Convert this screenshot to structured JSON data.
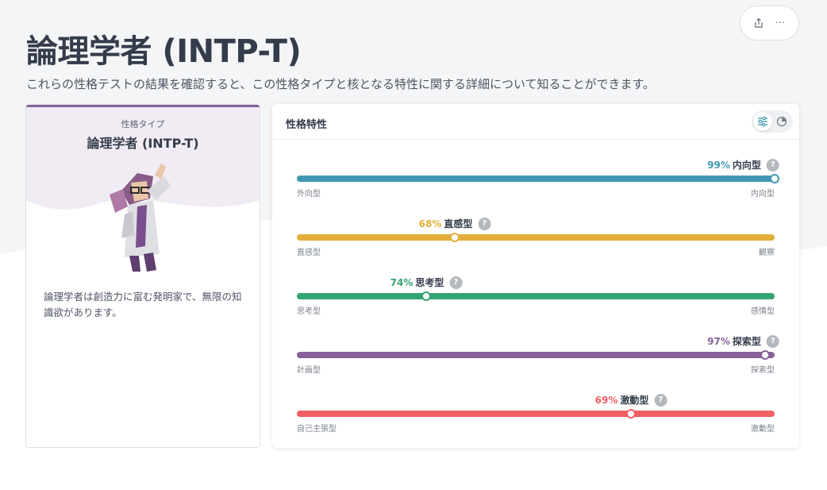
{
  "page": {
    "title": "論理学者 (INTP-T)",
    "description": "これらの性格テストの結果を確認すると、この性格タイプと核となる特性に関する詳細について知ることができます。"
  },
  "top_actions": {
    "icons": [
      "share-icon",
      "more-icon"
    ],
    "more_glyph": "···"
  },
  "type_card": {
    "kicker": "性格タイプ",
    "name": "論理学者 (INTP-T)",
    "description": "論理学者は創造力に富む発明家で、無限の知識欲があります。",
    "accent": "#88619a"
  },
  "traits_card": {
    "title": "性格特性",
    "view_toggle": [
      "sliders-icon",
      "pie-chart-icon"
    ],
    "traits": [
      {
        "percent": "99%",
        "name": "内向型",
        "left_pole": "外向型",
        "right_pole": "内向型",
        "position": 1.0,
        "color": "#4298b4",
        "help": "?"
      },
      {
        "percent": "68%",
        "name": "直感型",
        "left_pole": "直感型",
        "right_pole": "観察",
        "position": 0.33,
        "color": "#e4ae3a",
        "help": "?"
      },
      {
        "percent": "74%",
        "name": "思考型",
        "left_pole": "思考型",
        "right_pole": "感情型",
        "position": 0.27,
        "color": "#33a474",
        "help": "?"
      },
      {
        "percent": "97%",
        "name": "探索型",
        "left_pole": "計画型",
        "right_pole": "探索型",
        "position": 0.98,
        "color": "#88619a",
        "help": "?"
      },
      {
        "percent": "69%",
        "name": "激動型",
        "left_pole": "自己主張型",
        "right_pole": "激動型",
        "position": 0.7,
        "color": "#f25e62",
        "help": "?"
      }
    ]
  }
}
